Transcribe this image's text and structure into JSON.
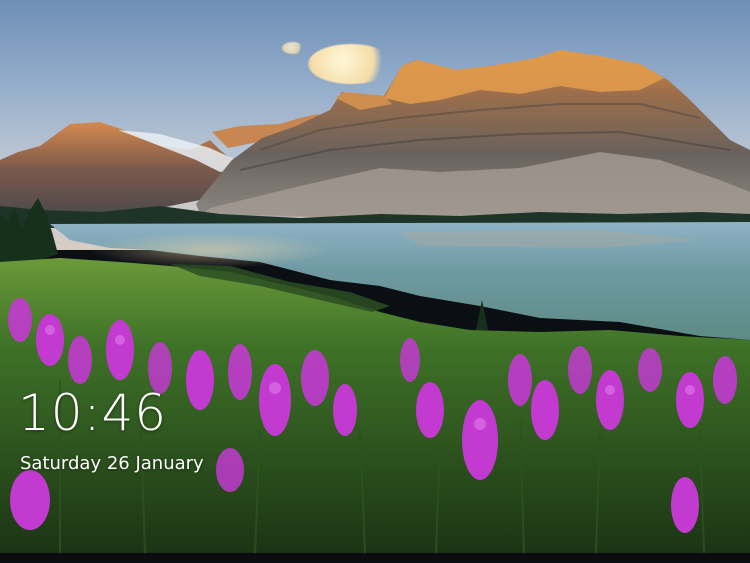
{
  "lock_screen": {
    "time": "10:46",
    "date": "Saturday 26 January"
  },
  "colors": {
    "sky_top": "#6f8fb6",
    "mountain_lit": "#c98a52",
    "mountain_shadow": "#5a5653",
    "lake": "#6f9aa6",
    "meadow": "#3f7a2a",
    "flowers": "#c23ad0",
    "text": "#ffffff"
  },
  "icons": [
    "lock-screen-wallpaper"
  ]
}
